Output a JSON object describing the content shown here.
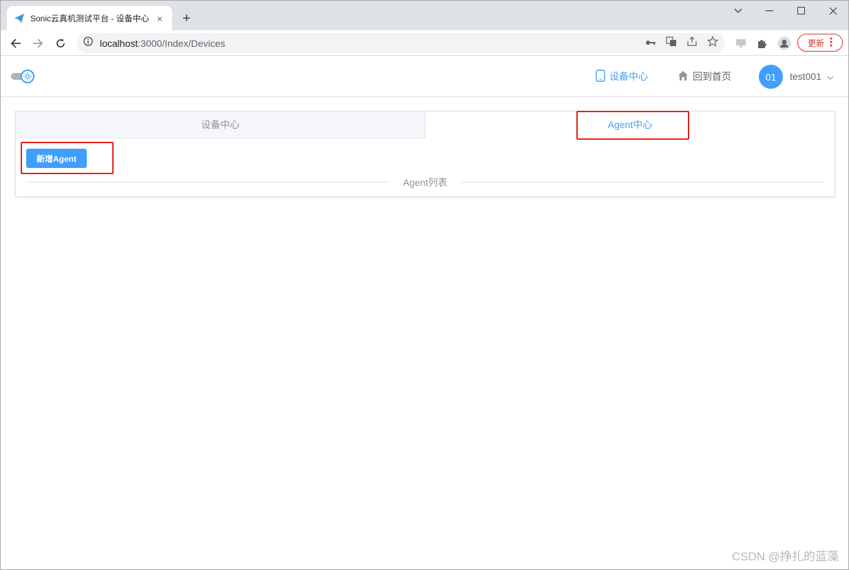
{
  "browser": {
    "tab_title": "Sonic云真机测试平台 - 设备中心",
    "tab_close": "×",
    "new_tab": "+",
    "url_host": "localhost",
    "url_path": ":3000/Index/Devices",
    "update_label": "更新"
  },
  "header": {
    "menu_devices": "设备中心",
    "menu_home": "回到首页",
    "avatar_text": "01",
    "username": "test001",
    "accent_color": "#409eff"
  },
  "card": {
    "tabs": [
      {
        "label": "设备中心",
        "active": false
      },
      {
        "label": "Agent中心",
        "active": true
      }
    ],
    "add_button": "新增Agent",
    "divider_label": "Agent列表"
  },
  "watermark": "CSDN @挣扎的蓝藻"
}
